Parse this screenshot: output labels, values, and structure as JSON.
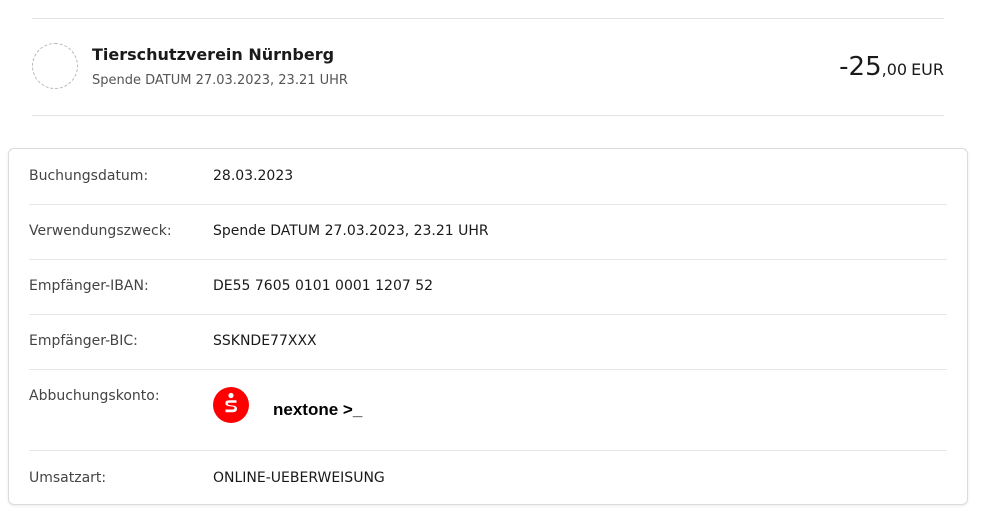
{
  "transaction": {
    "payee": "Tierschutzverein Nürnberg",
    "subtitle": "Spende DATUM 27.03.2023, 23.21 UHR",
    "amount_int": "-25",
    "amount_dec": ",00",
    "currency": "EUR"
  },
  "details": {
    "rows": [
      {
        "label": "Buchungsdatum:",
        "value": "28.03.2023"
      },
      {
        "label": "Verwendungszweck:",
        "value": "Spende DATUM 27.03.2023, 23.21 UHR"
      },
      {
        "label": "Empfänger-IBAN:",
        "value": "DE55 7605 0101 0001 1207 52"
      },
      {
        "label": "Empfänger-BIC:",
        "value": "SSKNDE77XXX"
      },
      {
        "label": "Abbuchungskonto:",
        "value": "nextone >_",
        "icon": "sparkasse-logo-icon"
      },
      {
        "label": "Umsatzart:",
        "value": "ONLINE-UEBERWEISUNG"
      }
    ]
  },
  "colors": {
    "sparkasse_red": "#ff0000",
    "separator": "#e6e6e6",
    "label_text": "#444444"
  }
}
